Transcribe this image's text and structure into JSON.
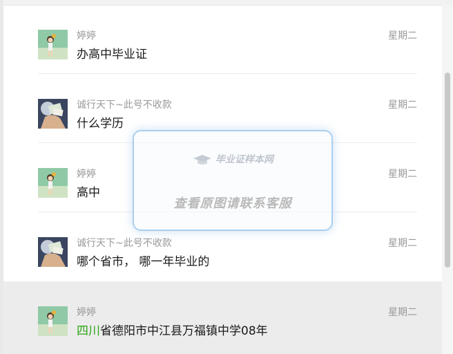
{
  "messages": [
    {
      "sender": "婷婷",
      "time": "星期二",
      "text": "办高中毕业证",
      "avatar": "girl-photo"
    },
    {
      "sender": "诚行天下~此号不收款",
      "time": "星期二",
      "text": "什么学历",
      "avatar": "hand-cash-photo"
    },
    {
      "sender": "婷婷",
      "time": "星期二",
      "text": "高中",
      "avatar": "girl-photo"
    },
    {
      "sender": "诚行天下~此号不收款",
      "time": "星期二",
      "text": "哪个省市， 哪一年毕业的",
      "avatar": "hand-cash-photo"
    },
    {
      "sender": "婷婷",
      "time": "星期二",
      "text_highlight": "四川",
      "text": "省德阳市中江县万福镇中学08年",
      "avatar": "girl-photo"
    }
  ],
  "watermark": {
    "logo_text": "毕业证样本网",
    "text": "查看原图请联系客服"
  },
  "colors": {
    "highlight": "#2aa515",
    "selected_bg": "#ececec",
    "meta_text": "#999999"
  }
}
